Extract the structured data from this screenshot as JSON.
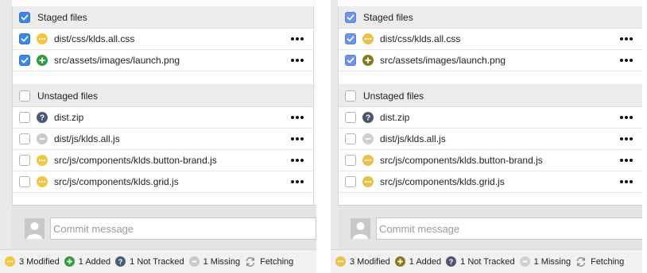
{
  "panels": [
    {
      "id": "left",
      "staged": {
        "header": "Staged files",
        "checked": true,
        "files": [
          {
            "name": "dist/css/klds.all.css",
            "status": "modified",
            "checked": true
          },
          {
            "name": "src/assets/images/launch.png",
            "status": "added",
            "checked": true
          }
        ]
      },
      "unstaged": {
        "header": "Unstaged files",
        "checked": false,
        "files": [
          {
            "name": "dist.zip",
            "status": "untracked",
            "checked": false
          },
          {
            "name": "dist/js/klds.all.js",
            "status": "missing",
            "checked": false
          },
          {
            "name": "src/js/components/klds.button-brand.js",
            "status": "modified",
            "checked": false
          },
          {
            "name": "src/js/components/klds.grid.js",
            "status": "modified",
            "checked": false
          }
        ]
      },
      "commit_placeholder": "Commit message",
      "statusbar": {
        "modified": "3 Modified",
        "added": "1 Added",
        "untracked": "1 Not Tracked",
        "missing": "1 Missing",
        "fetching": "Fetching"
      }
    },
    {
      "id": "right",
      "staged": {
        "header": "Staged files",
        "checked": true,
        "files": [
          {
            "name": "dist/css/klds.all.css",
            "status": "modified",
            "checked": true
          },
          {
            "name": "src/assets/images/launch.png",
            "status": "added",
            "checked": true
          }
        ]
      },
      "unstaged": {
        "header": "Unstaged files",
        "checked": false,
        "files": [
          {
            "name": "dist.zip",
            "status": "untracked",
            "checked": false
          },
          {
            "name": "dist/js/klds.all.js",
            "status": "missing",
            "checked": false
          },
          {
            "name": "src/js/components/klds.button-brand.js",
            "status": "modified",
            "checked": false
          },
          {
            "name": "src/js/components/klds.grid.js",
            "status": "modified",
            "checked": false
          }
        ]
      },
      "commit_placeholder": "Commit message",
      "statusbar": {
        "modified": "3 Modified",
        "added": "1 Added",
        "untracked": "1 Not Tracked",
        "missing": "1 Missing",
        "fetching": "Fetching"
      }
    }
  ],
  "icons": {
    "modified": "modified-dots-icon",
    "added": "added-plus-icon",
    "untracked": "untracked-question-icon",
    "missing": "missing-minus-icon",
    "fetching": "sync-arrows-icon",
    "more": "more-options-icon",
    "checkbox": "checkmark-icon",
    "avatar": "user-avatar-icon"
  },
  "colors": {
    "modified_left": "#f2c641",
    "added_left": "#2e9e3a",
    "untracked_left": "#4a5a78",
    "missing_left": "#c9c9c9",
    "modified_right": "#e8c14b",
    "added_right": "#8a7a1e",
    "untracked_right": "#4e5670",
    "missing_right": "#cfcfcf",
    "checkbox_left": "#3b87e6",
    "checkbox_right": "#6e93e8"
  }
}
